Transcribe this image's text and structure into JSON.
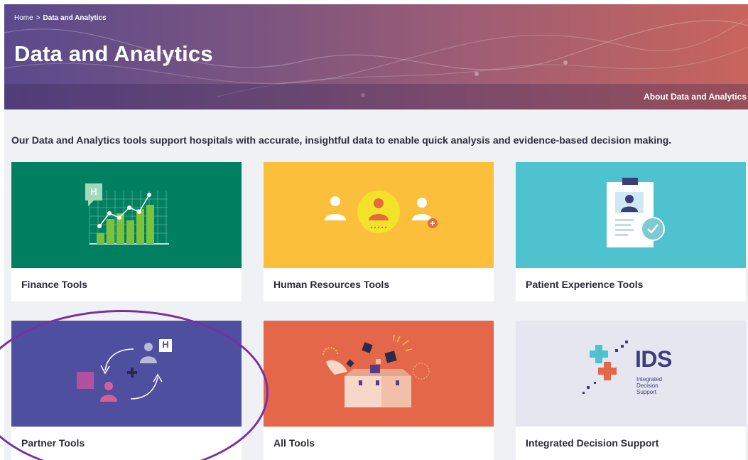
{
  "breadcrumb": {
    "home": "Home",
    "separator": ">",
    "current": "Data and Analytics"
  },
  "header": {
    "title": "Data and Analytics",
    "about_link": "About Data and Analytics"
  },
  "intro_text": "Our Data and Analytics tools support hospitals with accurate, insightful data to enable quick analysis and evidence-based decision making.",
  "cards": [
    {
      "label": "Finance Tools",
      "color": "#008060",
      "icon": "finance-chart-icon"
    },
    {
      "label": "Human Resources Tools",
      "color": "#fbbf3c",
      "icon": "people-icon"
    },
    {
      "label": "Patient Experience Tools",
      "color": "#4fc2cf",
      "icon": "clipboard-check-icon"
    },
    {
      "label": "Partner Tools",
      "color": "#4f4fa0",
      "icon": "partner-exchange-icon"
    },
    {
      "label": "All Tools",
      "color": "#e4674a",
      "icon": "open-box-icon"
    },
    {
      "label": "Integrated Decision Support",
      "color": "#e6e6f0",
      "icon": "ids-logo"
    }
  ],
  "ids_logo": {
    "acronym": "IDS",
    "line1": "Integrated",
    "line2": "Decision",
    "line3": "Support"
  },
  "finance_icon_letter": "H",
  "partner_icon_letter": "H"
}
